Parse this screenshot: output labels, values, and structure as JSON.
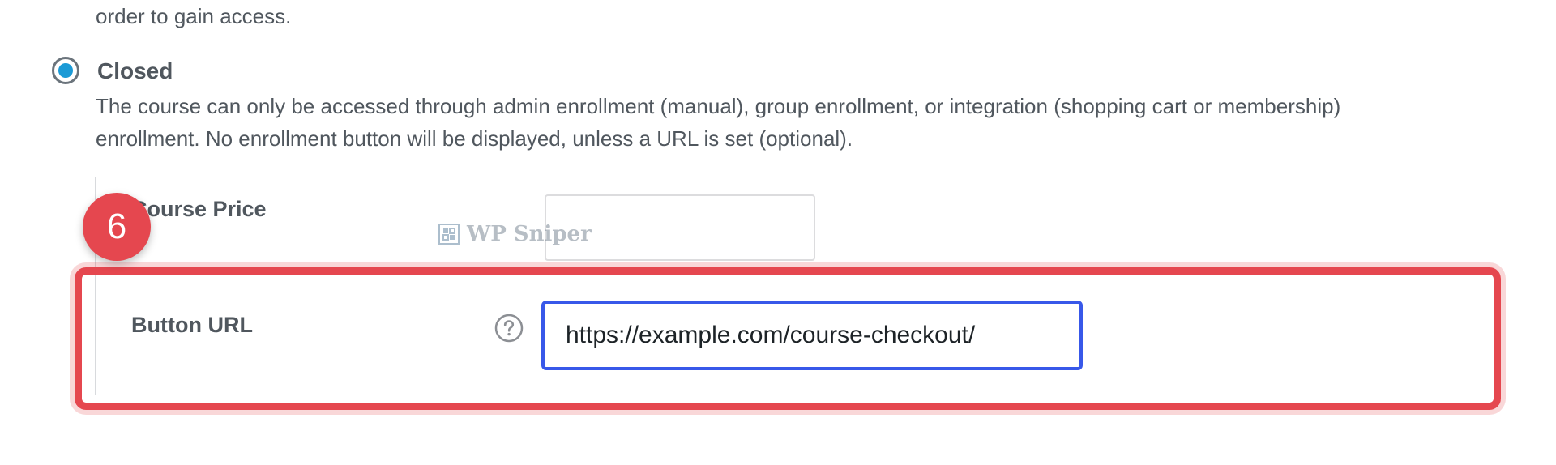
{
  "intro": {
    "text": "order to gain access."
  },
  "access_option": {
    "label": "Closed",
    "selected": true,
    "description": "The course can only be accessed through admin enrollment (manual), group enrollment, or integration (shopping cart or membership) enrollment. No enrollment button will be displayed, unless a URL is set (optional)."
  },
  "course_price": {
    "label": "Course Price",
    "value": ""
  },
  "button_url": {
    "label": "Button URL",
    "value": "https://example.com/course-checkout/",
    "help_icon": "help-circle-icon"
  },
  "annotation": {
    "step_number": "6",
    "highlight_color": "#e5474f"
  },
  "watermark": {
    "text": "WP Sniper",
    "icon": "wp-sniper-logo-icon"
  },
  "colors": {
    "radio_selected": "#1b9ad6",
    "focus_border": "#3858e9",
    "text": "#50575e"
  }
}
